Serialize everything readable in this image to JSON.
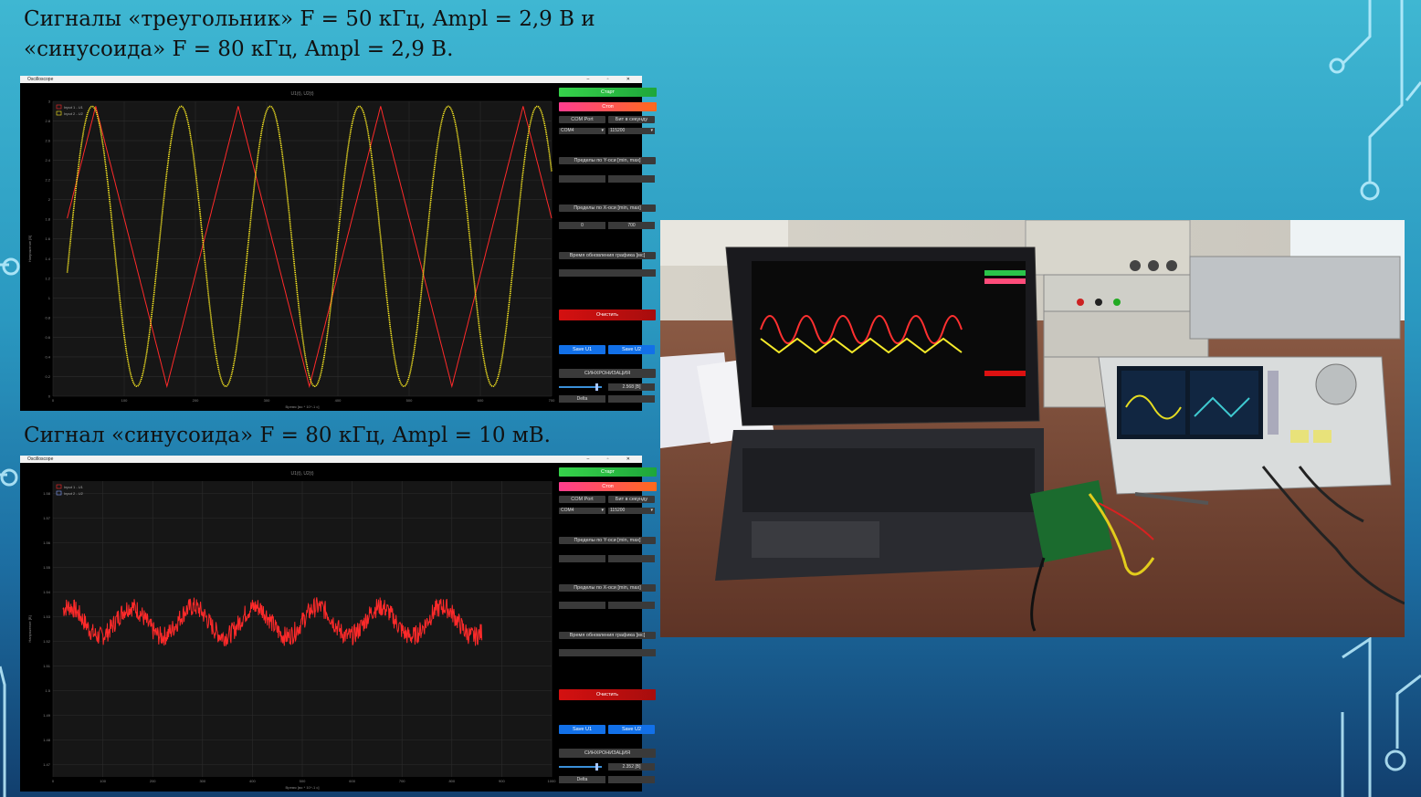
{
  "slide": {
    "caption_top_line1": "Сигналы «треугольник» F  =  50 кГц, Ampl =  2,9 В и",
    "caption_top_line2": "«синусоида» F  =  80 кГц, Ampl =  2,9 В.",
    "caption_bottom": "Сигнал «синусоида» F  =  80 кГц, Ampl =  10 мВ."
  },
  "window_top": {
    "title": "Oscilloscope",
    "controls": "– ▫ ✕",
    "plot_title": "U1(t), U2(t)",
    "x_axis_label": "Время [мс * 10^-1 c]",
    "y_axis_label": "Напряжение [В]",
    "legend": [
      "Input 1 - U1",
      "Input 2 - U2"
    ],
    "y_ticks": [
      "3",
      "2.8",
      "2.6",
      "2.4",
      "2.2",
      "2",
      "1.8",
      "1.6",
      "1.4",
      "1.2",
      "1",
      "0.8",
      "0.6",
      "0.4",
      "0.2",
      "0"
    ],
    "x_ticks": [
      "0",
      "100",
      "200",
      "300",
      "400",
      "500",
      "600",
      "700"
    ],
    "panel": {
      "start": "Старт",
      "stop": "Стоп",
      "com_port": "COM Port",
      "baud": "Бит в секунду",
      "com_value": "COM4",
      "baud_value": "115200",
      "y_limits": "Пределы по Y-оси [min, max]",
      "x_limits": "Пределы по X-оси [min, max]",
      "x_min": "0",
      "x_max": "700",
      "refresh": "Время обновления графика [мс]",
      "clear": "Очистить",
      "save_u1": "Save U1",
      "save_u2": "Save U2",
      "sync": "СИНХРОНИЗАЦИЯ",
      "sync_value": "2.568 [В]",
      "delta": "Delta"
    }
  },
  "window_bottom": {
    "title": "Oscilloscope",
    "controls": "– ▫ ✕",
    "plot_title": "U1(t), U2(t)",
    "x_axis_label": "Время [мс * 10^-1 c]",
    "y_axis_label": "Напряжение [В]",
    "legend": [
      "Input 1 - U1",
      "Input 2 - U2"
    ],
    "y_ticks": [
      "1.58",
      "1.57",
      "1.56",
      "1.55",
      "1.54",
      "1.53",
      "1.52",
      "1.51",
      "1.5",
      "1.49",
      "1.48",
      "1.47"
    ],
    "x_ticks": [
      "0",
      "100",
      "200",
      "300",
      "400",
      "500",
      "600",
      "700",
      "800",
      "900",
      "1000"
    ],
    "panel": {
      "start": "Старт",
      "stop": "Стоп",
      "com_port": "COM Port",
      "baud": "Бит в секунду",
      "com_value": "COM4",
      "baud_value": "115200",
      "y_limits": "Пределы по Y-оси [min, max]",
      "x_limits": "Пределы по X-оси [min, max]",
      "refresh": "Время обновления графика [мс]",
      "clear": "Очистить",
      "save_u1": "Save U1",
      "save_u2": "Save U2",
      "sync": "СИНХРОНИЗАЦИЯ",
      "sync_value": "2.352 [В]",
      "delta": "Delta"
    }
  },
  "chart_data": [
    {
      "type": "line",
      "title": "U1(t), U2(t)",
      "xlabel": "Время [мс * 10^-1 c]",
      "ylabel": "Напряжение [В]",
      "xlim": [
        0,
        700
      ],
      "ylim": [
        0,
        3
      ],
      "series": [
        {
          "name": "Input 1 - U1",
          "color": "#ff2a2a",
          "shape": "triangle",
          "period": 200,
          "min": 0.1,
          "max": 2.95,
          "phase": 60
        },
        {
          "name": "Input 2 - U2",
          "color": "#ffee22",
          "shape": "sine",
          "period": 125,
          "min": 0.1,
          "max": 2.95,
          "phase": 55
        }
      ]
    },
    {
      "type": "line",
      "title": "U1(t), U2(t)",
      "xlabel": "Время [мс * 10^-1 c]",
      "ylabel": "Напряжение [В]",
      "xlim": [
        0,
        1000
      ],
      "ylim": [
        1.465,
        1.585
      ],
      "series": [
        {
          "name": "Input 1 - U1",
          "color": "#ff2a2a",
          "shape": "noisy-sine",
          "period": 125,
          "center": 1.528,
          "amplitude": 0.006,
          "noise": 0.004,
          "x_end": 860
        }
      ]
    }
  ]
}
